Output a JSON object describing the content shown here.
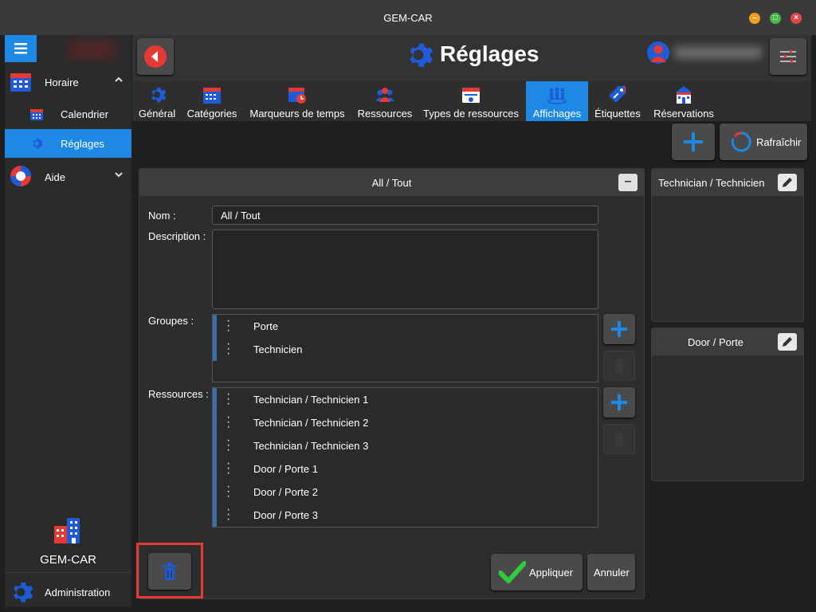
{
  "window": {
    "title": "GEM-CAR"
  },
  "sidebar": {
    "sections": [
      {
        "label": "Horaire",
        "expanded": true
      },
      {
        "label": "Aide",
        "expanded": false
      }
    ],
    "sub_items": [
      {
        "label": "Calendrier",
        "active": false
      },
      {
        "label": "Réglages",
        "active": true
      }
    ],
    "brand": "GEM-CAR",
    "admin": "Administration"
  },
  "header": {
    "title": "Réglages"
  },
  "tabs": [
    {
      "label": "Général",
      "icon": "gear-icon",
      "active": false
    },
    {
      "label": "Catégories",
      "icon": "calendar-grid-icon",
      "active": false
    },
    {
      "label": "Marqueurs de temps",
      "icon": "calendar-clock-icon",
      "active": false
    },
    {
      "label": "Ressources",
      "icon": "people-icon",
      "active": false
    },
    {
      "label": "Types de ressources",
      "icon": "id-card-icon",
      "active": false
    },
    {
      "label": "Affichages",
      "icon": "group-display-icon",
      "active": true
    },
    {
      "label": "Étiquettes",
      "icon": "tag-icon",
      "active": false
    },
    {
      "label": "Réservations",
      "icon": "building-icon",
      "active": false
    }
  ],
  "toolbar": {
    "refresh_label": "Rafraîchir"
  },
  "panel": {
    "title": "All / Tout",
    "name_label": "Nom :",
    "name_value": "All / Tout",
    "description_label": "Description :",
    "description_value": "",
    "groups_label": "Groupes :",
    "groups": [
      "Porte",
      "Technicien"
    ],
    "resources_label": "Ressources :",
    "resources": [
      "Technician / Technicien 1",
      "Technician / Technicien 2",
      "Technician / Technicien 3",
      "Door / Porte 1",
      "Door / Porte 2",
      "Door / Porte 3"
    ],
    "apply_label": "Appliquer",
    "cancel_label": "Annuler"
  },
  "cards": [
    {
      "title": "Technician / Technicien"
    },
    {
      "title": "Door / Porte"
    }
  ],
  "colors": {
    "accent": "#1e88e5",
    "danger": "#e53935",
    "success": "#2ecc40",
    "icon_blue": "#1e5bd8"
  }
}
